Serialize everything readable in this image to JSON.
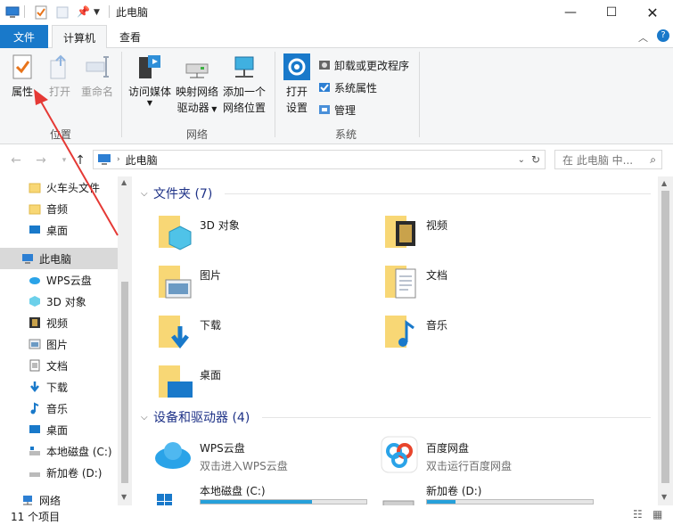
{
  "titlebar": {
    "title": "此电脑",
    "icons": [
      "computer-icon",
      "properties-check-icon",
      "new-folder-icon",
      "pin-icon",
      "dropdown-icon"
    ],
    "controls": [
      "minimize",
      "maximize",
      "close"
    ]
  },
  "tabs": {
    "file": "文件",
    "computer": "计算机",
    "view": "查看"
  },
  "ribbon": {
    "location": {
      "label": "位置",
      "properties": "属性",
      "open": "打开",
      "rename": "重命名"
    },
    "network": {
      "label": "网络",
      "access_media": "访问媒体",
      "map_drive_line1": "映射网络",
      "map_drive_line2": "驱动器",
      "add_location_line1": "添加一个",
      "add_location_line2": "网络位置"
    },
    "system": {
      "label": "系统",
      "open_settings_line1": "打开",
      "open_settings_line2": "设置",
      "uninstall": "卸载或更改程序",
      "system_props": "系统属性",
      "manage": "管理"
    }
  },
  "address": {
    "path": "此电脑",
    "search_placeholder": "在 此电脑 中..."
  },
  "nav": {
    "items": [
      {
        "label": "火车头文件",
        "icon": "folder-icon"
      },
      {
        "label": "音频",
        "icon": "folder-icon"
      },
      {
        "label": "桌面",
        "icon": "desktop-icon"
      },
      {
        "label": "此电脑",
        "icon": "computer-icon"
      },
      {
        "label": "WPS云盘",
        "icon": "cloud-icon"
      },
      {
        "label": "3D 对象",
        "icon": "cube-icon"
      },
      {
        "label": "视频",
        "icon": "video-icon"
      },
      {
        "label": "图片",
        "icon": "picture-icon"
      },
      {
        "label": "文档",
        "icon": "document-icon"
      },
      {
        "label": "下载",
        "icon": "download-icon"
      },
      {
        "label": "音乐",
        "icon": "music-icon"
      },
      {
        "label": "桌面",
        "icon": "desktop-icon"
      },
      {
        "label": "本地磁盘 (C:)",
        "icon": "drive-icon"
      },
      {
        "label": "新加卷 (D:)",
        "icon": "drive-icon"
      },
      {
        "label": "网络",
        "icon": "network-icon"
      }
    ]
  },
  "folders": {
    "heading": "文件夹 (7)",
    "items": [
      {
        "label": "3D 对象",
        "icon": "cube-folder-icon"
      },
      {
        "label": "视频",
        "icon": "video-folder-icon"
      },
      {
        "label": "图片",
        "icon": "picture-folder-icon"
      },
      {
        "label": "文档",
        "icon": "document-folder-icon"
      },
      {
        "label": "下载",
        "icon": "download-folder-icon"
      },
      {
        "label": "音乐",
        "icon": "music-folder-icon"
      },
      {
        "label": "桌面",
        "icon": "desktop-folder-icon"
      }
    ]
  },
  "devices": {
    "heading": "设备和驱动器 (4)",
    "items": [
      {
        "label": "WPS云盘",
        "sub": "双击进入WPS云盘",
        "icon": "wps-cloud-icon"
      },
      {
        "label": "百度网盘",
        "sub": "双击运行百度网盘",
        "icon": "baidu-netdisk-icon"
      },
      {
        "label": "本地磁盘 (C:)",
        "icon": "windows-drive-icon",
        "used": 0.67
      },
      {
        "label": "新加卷 (D:)",
        "icon": "drive-icon",
        "used": 0.17
      }
    ]
  },
  "status": {
    "count": "11 个项目"
  },
  "colors": {
    "accent": "#1979ca",
    "folder": "#f8d775",
    "drive_fill": "#26a0da",
    "annotation_arrow": "#e53935"
  }
}
